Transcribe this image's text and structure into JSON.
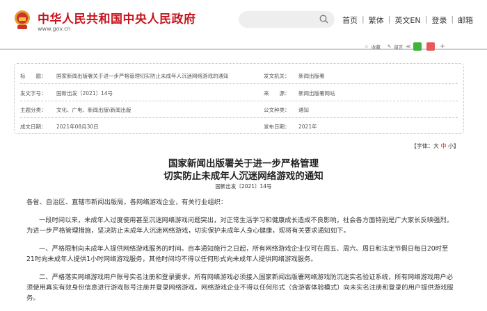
{
  "header": {
    "site_title": "中华人民共和国中央人民政府",
    "site_url": "www.gov.cn",
    "nav": [
      "首页",
      "繁体",
      "英文EN",
      "登录",
      "邮箱"
    ]
  },
  "share": {
    "favorite": "收藏",
    "comment": "留言",
    "plus": "+"
  },
  "info": {
    "rows": [
      {
        "l1": "标　　题：",
        "v1": "国家新闻出版署关于进一步严格管理切实防止未成年人沉迷网络游戏的通知",
        "l2": "发文机关：",
        "v2": "新闻出版署"
      },
      {
        "l1": "发文字号：",
        "v1": "国新出发〔2021〕14号",
        "l2": "来　　源：",
        "v2": "新闻出版署网站"
      },
      {
        "l1": "主题分类：",
        "v1": "文化、广电、新闻出版\\新闻出版",
        "l2": "公文种类：",
        "v2": "通知"
      },
      {
        "l1": "成文日期：",
        "v1": "2021年08月30日",
        "l2": "发布日期：",
        "v2": "2021年"
      }
    ]
  },
  "font_size": {
    "prefix": "【字体：",
    "large": "大",
    "medium": "中",
    "small": "小",
    "suffix": "】"
  },
  "article": {
    "title_line1": "国家新闻出版署关于进一步严格管理",
    "title_line2": "切实防止未成年人沉迷网络游戏的通知",
    "doc_number": "国新出发〔2021〕14号",
    "paragraphs": [
      "各省、自治区、直辖市新闻出版局，各网络游戏企业，有关行业组织：",
      "一段时间以来，未成年人过度使用甚至沉迷网络游戏问题突出，对正常生活学习和健康成长造成不良影响，社会各方面特别是广大家长反映强烈。为进一步严格管理措施，坚决防止未成年人沉迷网络游戏，切实保护未成年人身心健康，现将有关要求通知如下。",
      "一、严格限制向未成年人提供网络游戏服务的时间。自本通知施行之日起，所有网络游戏企业仅可在周五、周六、周日和法定节假日每日20时至21时向未成年人提供1小时网络游戏服务，其他时间均不得以任何形式向未成年人提供网络游戏服务。",
      "二、严格落实网络游戏用户账号实名注册和登录要求。所有网络游戏必须接入国家新闻出版署网络游戏防沉迷实名验证系统，所有网络游戏用户必须使用真实有效身份信息进行游戏账号注册并登录网络游戏。网络游戏企业不得以任何形式（含游客体验模式）向未实名注册和登录的用户提供游戏服务。"
    ]
  }
}
